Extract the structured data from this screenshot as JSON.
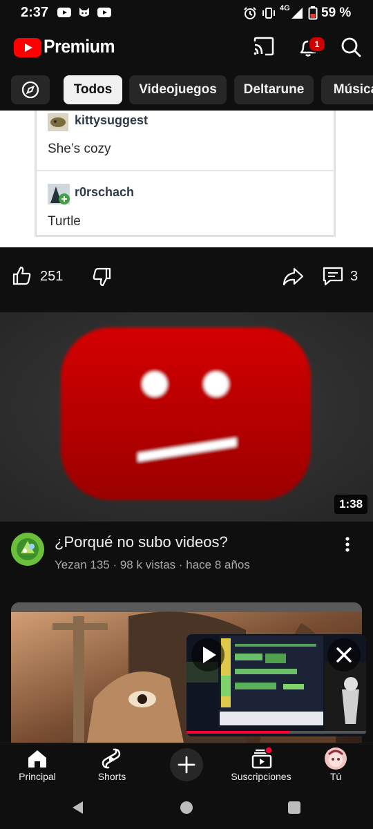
{
  "status_bar": {
    "time": "2:37",
    "network": "4G",
    "battery": "59 %"
  },
  "header": {
    "brand": "Premium",
    "notification_count": "1"
  },
  "chips": [
    {
      "label": "Todos",
      "active": true
    },
    {
      "label": "Videojuegos",
      "active": false
    },
    {
      "label": "Deltarune",
      "active": false
    },
    {
      "label": "Música",
      "active": false
    }
  ],
  "post": {
    "comments": [
      {
        "user": "kittysuggest",
        "text": "She’s cozy"
      },
      {
        "user": "r0rschach",
        "text": "Turtle"
      }
    ],
    "likes": "251",
    "comments_count": "3"
  },
  "video": {
    "duration": "1:38",
    "title": "¿Porqué no subo videos?",
    "meta": "Yezan 135 · 98 k vistas · hace 8 años"
  },
  "bottom_nav": [
    {
      "label": "Principal"
    },
    {
      "label": "Shorts"
    },
    {
      "label": "Suscripciones"
    },
    {
      "label": "Tú"
    }
  ]
}
